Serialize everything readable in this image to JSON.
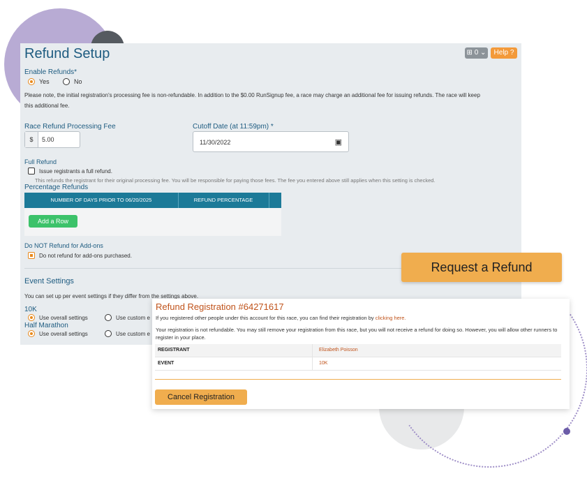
{
  "refund_setup": {
    "title": "Refund Setup",
    "gear_button": "⊞ 0 ⌄",
    "help_button": "Help ?",
    "enable_refunds": {
      "label": "Enable Refunds*",
      "yes": "Yes",
      "no": "No",
      "selected": "Yes"
    },
    "note": "Please note, the initial registration's processing fee is non-refundable. In addition to the $0.00 RunSignup fee, a race may charge an additional fee for issuing refunds. The race will keep",
    "note2": "this additional fee.",
    "processing_fee": {
      "label": "Race Refund Processing Fee",
      "currency": "$",
      "value": "5.00"
    },
    "cutoff": {
      "label": "Cutoff Date (at 11:59pm) *",
      "value": "11/30/2022"
    },
    "full_refund": {
      "heading": "Full Refund",
      "checkbox_label": "Issue registrants a full refund.",
      "checked": false,
      "hint": "This refunds the registrant for their original processing fee. You will be responsible for paying those fees. The fee you entered above still applies when this setting is checked."
    },
    "percentage_refunds": {
      "heading": "Percentage Refunds",
      "columns": [
        "NUMBER OF DAYS PRIOR TO 06/20/2025",
        "REFUND PERCENTAGE"
      ],
      "add_row": "Add a Row"
    },
    "addons": {
      "heading": "Do NOT Refund for Add-ons",
      "checkbox_label": "Do not refund for add-ons purchased.",
      "checked": true
    },
    "event_settings": {
      "heading": "Event Settings",
      "desc": "You can set up per event settings if they differ from the settings above.",
      "events": [
        {
          "name": "10K",
          "opt1": "Use overall settings",
          "opt2": "Use custom e"
        },
        {
          "name": "Half Marathon",
          "opt1": "Use overall settings",
          "opt2": "Use custom e"
        }
      ]
    }
  },
  "callout": {
    "label": "Request a Refund"
  },
  "refund_registration": {
    "title": "Refund Registration #64271617",
    "line1": "If you registered other people under this account for this race, you can find their registration by",
    "line1_link": "clicking here.",
    "line2": "Your registration is not refundable. You may still remove your registration from this race, but you will not receive a refund for doing so. However, you will allow other runners to register in your place.",
    "rows": [
      {
        "key": "REGISTRANT",
        "value": "Elizabeth Poisson"
      },
      {
        "key": "EVENT",
        "value": "10K"
      }
    ],
    "cancel_button": "Cancel Registration"
  },
  "colors": {
    "title_blue": "#1d5b80",
    "accent_orange": "#f0ad4e",
    "table_head": "#1c7a98",
    "add_row_green": "#3cc26a",
    "link_orange": "#c0531b"
  }
}
